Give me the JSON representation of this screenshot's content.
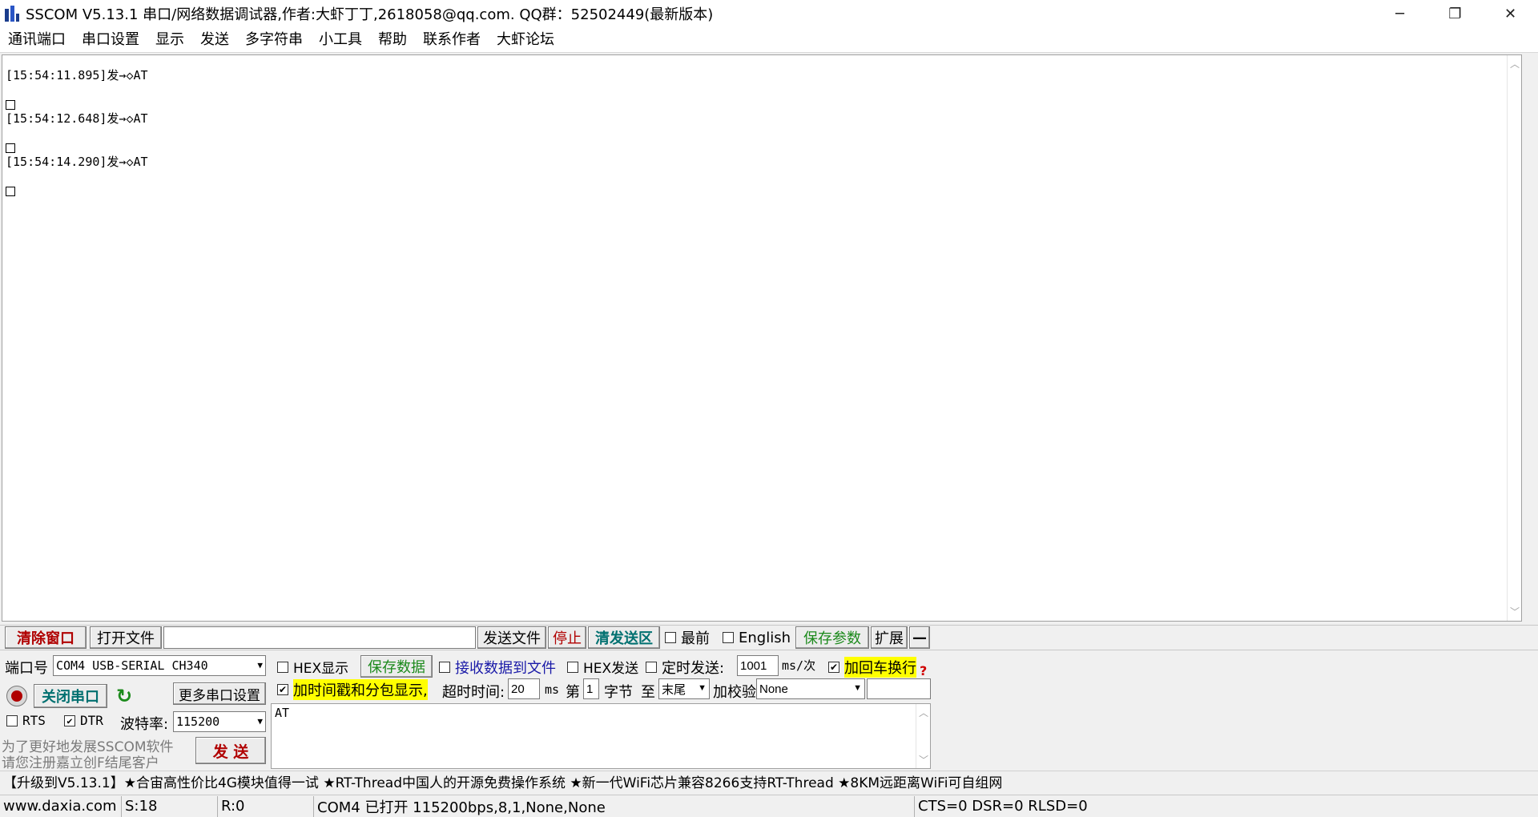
{
  "window": {
    "title": "SSCOM V5.13.1 串口/网络数据调试器,作者:大虾丁丁,2618058@qq.com. QQ群：52502449(最新版本)",
    "controls": [
      "─",
      "❐",
      "✕"
    ]
  },
  "menu": [
    "通讯端口",
    "串口设置",
    "显示",
    "发送",
    "多字符串",
    "小工具",
    "帮助",
    "联系作者",
    "大虾论坛"
  ],
  "receive": {
    "lines": [
      "[15:54:11.895]发→◇AT",
      "[15:54:12.648]发→◇AT",
      "[15:54:14.290]发→◇AT"
    ]
  },
  "toolbar": {
    "clear_window": "清除窗口",
    "open_file": "打开文件",
    "send_file": "发送文件",
    "stop": "停止",
    "clear_send": "清发送区",
    "topmost": "最前",
    "english": "English",
    "save_params": "保存参数",
    "expand": "扩展",
    "collapse": "—"
  },
  "port": {
    "label": "端口号",
    "value": "COM4 USB-SERIAL CH340",
    "close_button": "关闭串口",
    "more_settings": "更多串口设置",
    "rts_label": "RTS",
    "dtr_label": "DTR",
    "rts_checked": false,
    "dtr_checked": true,
    "baud_label": "波特率:",
    "baud_value": "115200"
  },
  "options": {
    "hex_display": "HEX显示",
    "save_data": "保存数据",
    "recv_to_file": "接收数据到文件",
    "hex_send": "HEX发送",
    "timed_send": "定时发送:",
    "interval_value": "1001",
    "interval_unit": "ms/次",
    "add_crlf": "加回车换行",
    "add_timestamp": "加时间戳和分包显示,",
    "timeout_label": "超时时间:",
    "timeout_value": "20",
    "timeout_unit": "ms",
    "byte_prefix": "第",
    "byte_index": "1",
    "byte_suffix": "字节",
    "to_label": "至",
    "to_value": "末尾",
    "checksum_label": "加校验",
    "checksum_value": "None",
    "help_mark": "?"
  },
  "send": {
    "text": "AT",
    "button": "发 送"
  },
  "promo": {
    "line1": "为了更好地发展SSCOM软件",
    "line2": "请您注册嘉立创F结尾客户"
  },
  "news": "【升级到V5.13.1】★合宙高性价比4G模块值得一试 ★RT-Thread中国人的开源免费操作系统 ★新一代WiFi芯片兼容8266支持RT-Thread ★8KM远距离WiFi可自组网",
  "status": {
    "website": "www.daxia.com",
    "sent": "S:18",
    "received": "R:0",
    "port_state": "COM4 已打开  115200bps,8,1,None,None",
    "signals": "CTS=0 DSR=0 RLSD=0"
  }
}
